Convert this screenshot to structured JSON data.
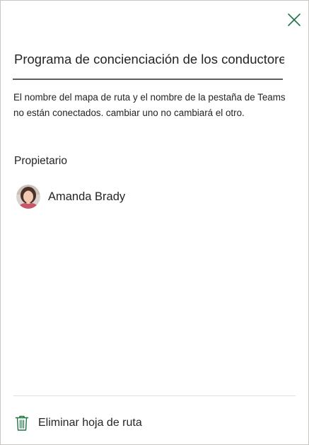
{
  "panel": {
    "title_value": "Programa de concienciación de los conductores",
    "notice": "El nombre del mapa de ruta y el nombre de la pestaña de Teams no están conectados. cambiar uno no cambiará el otro.",
    "owner_label": "Propietario",
    "owner_name": "Amanda Brady",
    "delete_label": "Eliminar hoja de ruta"
  },
  "icons": {
    "close": "close-icon",
    "delete": "trash-icon",
    "avatar": "user-avatar-photo"
  },
  "colors": {
    "accent_green": "#217346",
    "text": "#252423",
    "underline": "#605e5c",
    "divider": "#e1dfdd"
  }
}
